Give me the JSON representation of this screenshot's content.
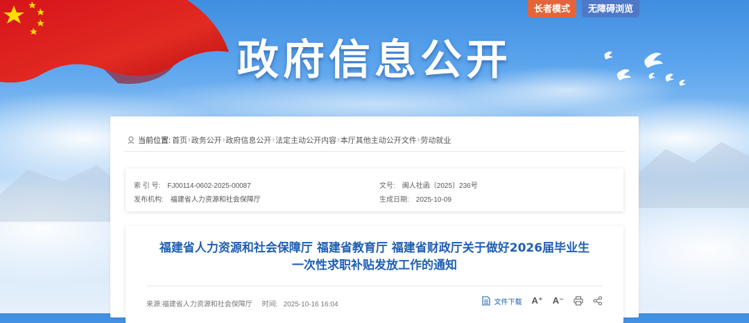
{
  "header": {
    "site_title": "政府信息公开",
    "buttons": {
      "elder_mode": "长者模式",
      "accessible": "无障碍浏览"
    }
  },
  "breadcrumb": {
    "prefix": "当前位置:",
    "items": [
      "首页",
      "政务公开",
      "政府信息公开",
      "法定主动公开内容",
      "本厅其他主动公开文件",
      "劳动就业"
    ]
  },
  "meta": {
    "index_label": "索 引 号:",
    "index_value": "FJ00114-0602-2025-00087",
    "docno_label": "文号:",
    "docno_value": "闽人社函〔2025〕236号",
    "issuer_label": "发布机构:",
    "issuer_value": "福建省人力资源和社会保障厅",
    "date_label": "生成日期:",
    "date_value": "2025-10-09"
  },
  "article": {
    "title_line1": "福建省人力资源和社会保障厅 福建省教育厅 福建省财政厅关于做好2026届毕业生",
    "title_line2": "一次性求职补贴发放工作的通知",
    "source_label": "来源:",
    "source_value": "福建省人力资源和社会保障厅",
    "time_label": "时间:",
    "time_value": "2025-10-16 16:04",
    "download_label": "文件下载",
    "font_increase": "A⁺",
    "font_decrease": "A⁻"
  },
  "colors": {
    "title_blue": "#1f5fb5",
    "elder_btn": "#e5653a",
    "access_btn": "#4f79c7"
  }
}
